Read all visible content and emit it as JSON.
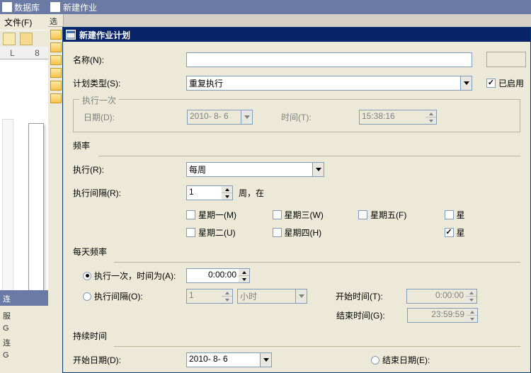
{
  "bgwin": {
    "title": "数据库",
    "menu_file": "文件(F)",
    "ruler": {
      "a": "L",
      "b": "8"
    },
    "panel_title": "连",
    "panel_l1": "服",
    "panel_l2": "G",
    "panel_l3": "连",
    "panel_l4": "G"
  },
  "midwin": {
    "title": "新建作业",
    "left_hdr": "选"
  },
  "dlg": {
    "title": "新建作业计划",
    "name_label": "名称(N):",
    "name_value": "",
    "type_label": "计划类型(S):",
    "type_value": "重复执行",
    "enabled_label": "已启用",
    "once": {
      "group": "执行一次",
      "date_label": "日期(D):",
      "date_value": "2010- 8- 6",
      "time_label": "时间(T):",
      "time_value": "15:38:16"
    },
    "freq": {
      "title": "频率",
      "exec_label": "执行(R):",
      "exec_value": "每周",
      "interval_label": "执行间隔(R):",
      "interval_value": "1",
      "interval_suffix": "周，在",
      "d_mon": "星期一(M)",
      "d_wed": "星期三(W)",
      "d_fri": "星期五(F)",
      "d_tue": "星期二(U)",
      "d_thu": "星期四(H)",
      "d_sat_partial": "星"
    },
    "daily": {
      "title": "每天频率",
      "once_label": "执行一次，时间为(A):",
      "once_value": "0:00:00",
      "interval_label": "执行间隔(O):",
      "interval_value": "1",
      "interval_unit": "小时",
      "start_label": "开始时间(T):",
      "start_value": "0:00:00",
      "end_label": "结束时间(G):",
      "end_value": "23:59:59"
    },
    "duration": {
      "title": "持续时间",
      "start_label": "开始日期(D):",
      "start_value": "2010- 8- 6",
      "end_label": "结束日期(E):"
    }
  }
}
